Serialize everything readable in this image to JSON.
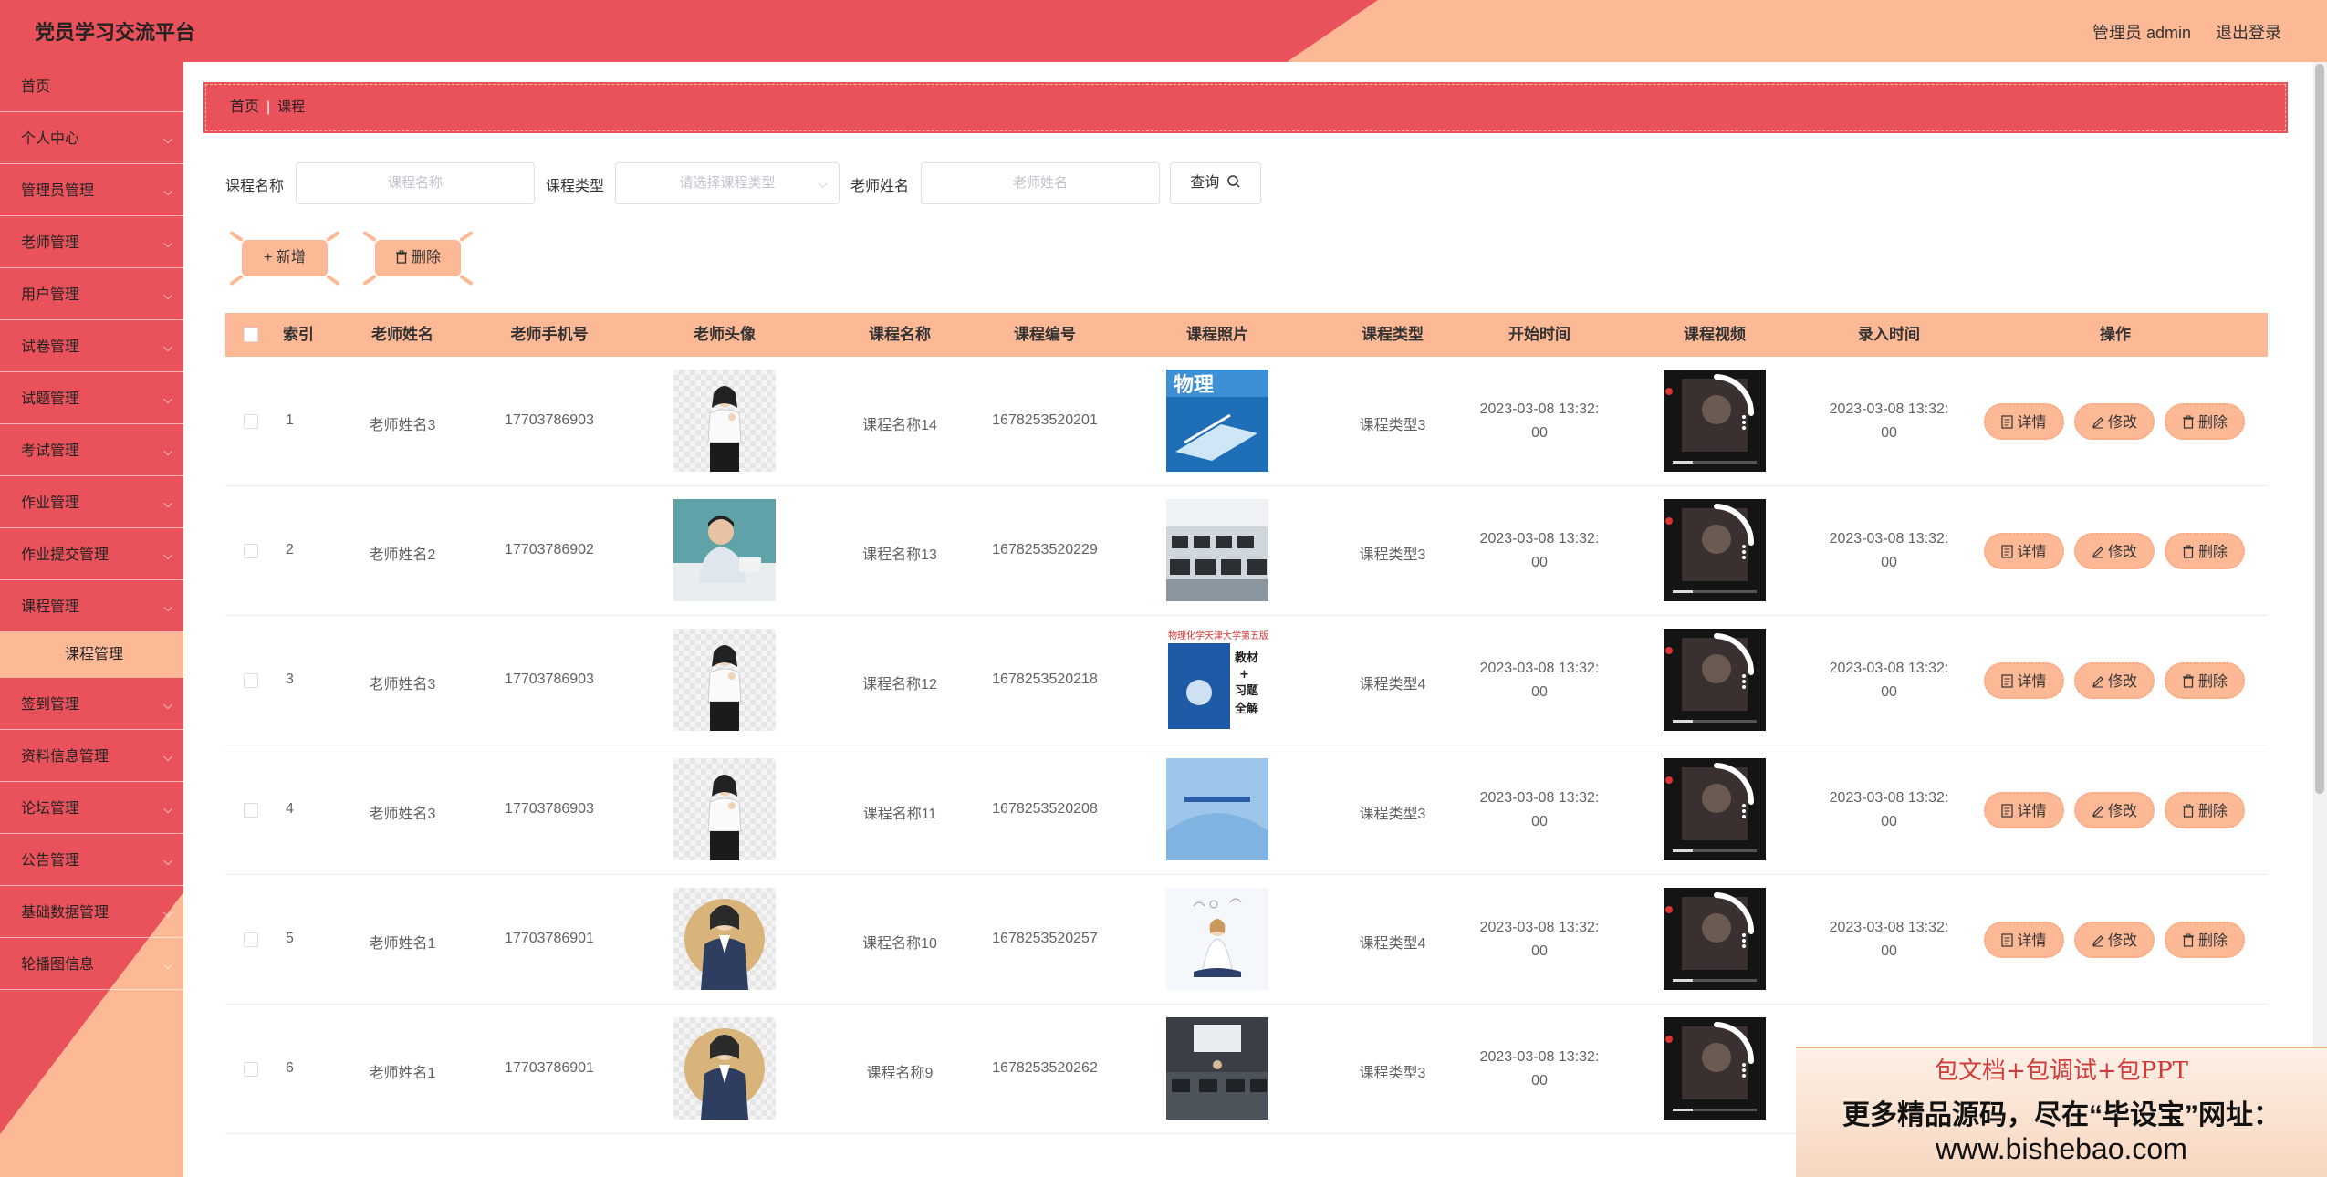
{
  "header": {
    "title": "党员学习交流平台",
    "user": "管理员 admin",
    "logout": "退出登录"
  },
  "sidebar": {
    "items": [
      {
        "label": "首页",
        "chevron": false
      },
      {
        "label": "个人中心",
        "chevron": true
      },
      {
        "label": "管理员管理",
        "chevron": true
      },
      {
        "label": "老师管理",
        "chevron": true
      },
      {
        "label": "用户管理",
        "chevron": true
      },
      {
        "label": "试卷管理",
        "chevron": true
      },
      {
        "label": "试题管理",
        "chevron": true
      },
      {
        "label": "考试管理",
        "chevron": true
      },
      {
        "label": "作业管理",
        "chevron": true
      },
      {
        "label": "作业提交管理",
        "chevron": true
      },
      {
        "label": "课程管理",
        "chevron": true
      },
      {
        "label": "签到管理",
        "chevron": true
      },
      {
        "label": "资料信息管理",
        "chevron": true
      },
      {
        "label": "论坛管理",
        "chevron": true
      },
      {
        "label": "公告管理",
        "chevron": true
      },
      {
        "label": "基础数据管理",
        "chevron": true
      },
      {
        "label": "轮播图信息",
        "chevron": true
      }
    ],
    "sub_item": "课程管理"
  },
  "breadcrumb": {
    "home": "首页",
    "sep": "|",
    "current": "课程"
  },
  "search": {
    "course_name_label": "课程名称",
    "course_name_placeholder": "课程名称",
    "course_type_label": "课程类型",
    "course_type_placeholder": "请选择课程类型",
    "teacher_name_label": "老师姓名",
    "teacher_name_placeholder": "老师姓名",
    "query_label": "查询",
    "search_icon": "search-icon"
  },
  "actions": {
    "add_label": "+ 新增",
    "delete_label": "删除"
  },
  "table": {
    "columns": [
      "索引",
      "老师姓名",
      "老师手机号",
      "老师头像",
      "课程名称",
      "课程编号",
      "课程照片",
      "课程类型",
      "开始时间",
      "课程视频",
      "录入时间",
      "操作"
    ],
    "ops": {
      "detail": "详情",
      "edit": "修改",
      "delete": "删除"
    },
    "rows": [
      {
        "index": "1",
        "teacher": "老师姓名3",
        "phone": "17703786903",
        "course": "课程名称14",
        "code": "1678253520201",
        "type": "课程类型3",
        "start_l1": "2023-03-08 13:32:",
        "start_l2": "00",
        "entry_l1": "2023-03-08 13:32:",
        "entry_l2": "00",
        "avatar": "woman-white",
        "photo": "physics-book"
      },
      {
        "index": "2",
        "teacher": "老师姓名2",
        "phone": "17703786902",
        "course": "课程名称13",
        "code": "1678253520229",
        "type": "课程类型3",
        "start_l1": "2023-03-08 13:32:",
        "start_l2": "00",
        "entry_l1": "2023-03-08 13:32:",
        "entry_l2": "00",
        "avatar": "man-desk",
        "photo": "computer-lab"
      },
      {
        "index": "3",
        "teacher": "老师姓名3",
        "phone": "17703786903",
        "course": "课程名称12",
        "code": "1678253520218",
        "type": "课程类型4",
        "start_l1": "2023-03-08 13:32:",
        "start_l2": "00",
        "entry_l1": "2023-03-08 13:32:",
        "entry_l2": "00",
        "avatar": "woman-white",
        "photo": "textbook-cover"
      },
      {
        "index": "4",
        "teacher": "老师姓名3",
        "phone": "17703786903",
        "course": "课程名称11",
        "code": "1678253520208",
        "type": "课程类型3",
        "start_l1": "2023-03-08 13:32:",
        "start_l2": "00",
        "entry_l1": "2023-03-08 13:32:",
        "entry_l2": "00",
        "avatar": "woman-white",
        "photo": "blue-cover"
      },
      {
        "index": "5",
        "teacher": "老师姓名1",
        "phone": "17703786901",
        "course": "课程名称10",
        "code": "1678253520257",
        "type": "课程类型4",
        "start_l1": "2023-03-08 13:32:",
        "start_l2": "00",
        "entry_l1": "2023-03-08 13:32:",
        "entry_l2": "00",
        "avatar": "woman-suit",
        "photo": "sitting-person"
      },
      {
        "index": "6",
        "teacher": "老师姓名1",
        "phone": "17703786901",
        "course": "课程名称9",
        "code": "1678253520262",
        "type": "课程类型3",
        "start_l1": "2023-03-08 13:32:",
        "start_l2": "00",
        "entry_l1": "",
        "entry_l2": "",
        "avatar": "woman-suit",
        "photo": "classroom"
      }
    ]
  },
  "watermark": {
    "line1": "包文档+包调试+包PPT",
    "line2": "更多精品源码，尽在“毕设宝”网址：",
    "line3": "www.bishebao.com"
  },
  "colors": {
    "primary": "#e9525a",
    "accent": "#fdb895"
  }
}
